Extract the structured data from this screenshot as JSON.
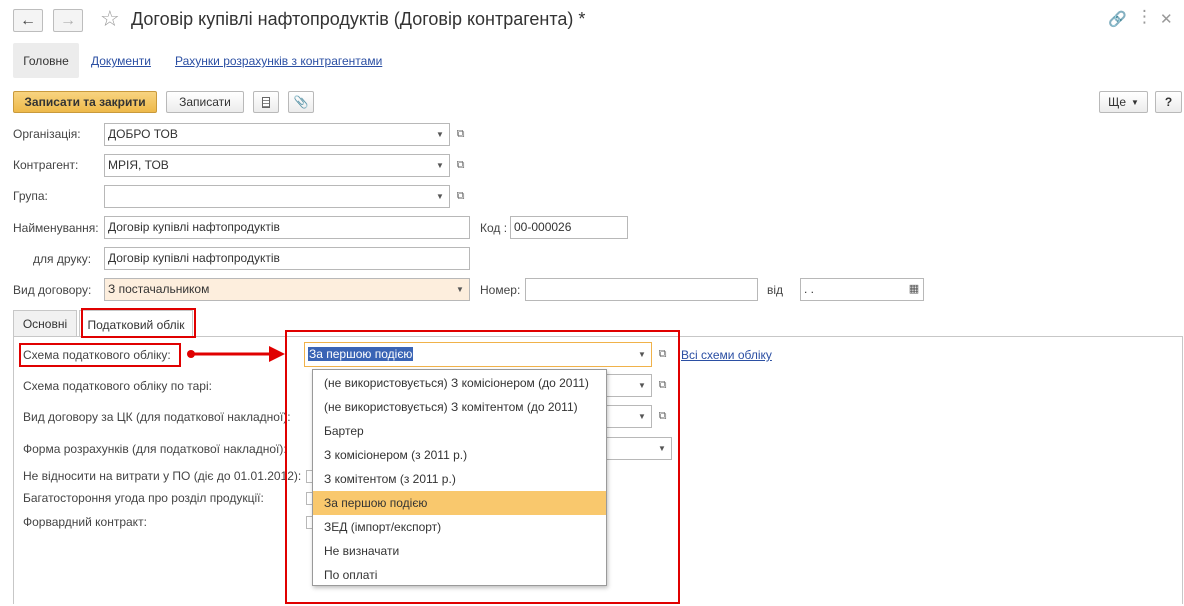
{
  "window": {
    "title": "Договір купівлі нафтопродуктів (Договір контрагента) *",
    "back_icon": "arrow-left-icon",
    "forward_icon": "arrow-right-icon"
  },
  "top_tabs": {
    "main": "Головне",
    "documents": "Документи",
    "accounts": "Рахунки розрахунків з контрагентами"
  },
  "toolbar": {
    "save_close": "Записати та закрити",
    "save": "Записати",
    "more": "Ще",
    "help": "?"
  },
  "form": {
    "organization": {
      "label": "Організація:",
      "value": "ДОБРО ТОВ"
    },
    "counterparty": {
      "label": "Контрагент:",
      "value": "МРІЯ, ТОВ"
    },
    "group": {
      "label": "Група:",
      "value": ""
    },
    "name": {
      "label": "Найменування:",
      "value": "Договір купівлі нафтопродуктів"
    },
    "code": {
      "label": "Код :",
      "value": "00-000026"
    },
    "print_name": {
      "label": "для друку:",
      "value": "Договір купівлі нафтопродуктів"
    },
    "contract_type": {
      "label": "Вид договору:",
      "value": "З постачальником"
    },
    "number": {
      "label": "Номер:",
      "value": ""
    },
    "date": {
      "label": "від",
      "value": " .  ."
    }
  },
  "page_tabs": {
    "basic": "Основні",
    "tax": "Податковий облік"
  },
  "tax_panel": {
    "scheme_label": "Схема податкового обліку:",
    "scheme_value": "За першою подією",
    "all_schemes_link": "Всі схеми обліку",
    "tare_scheme_label": "Схема податкового обліку по тарі:",
    "ck_type_label": "Вид договору за ЦК (для податкової накладної):",
    "payment_form_label": "Форма розрахунків (для податкової накладної):",
    "no_expense_label": "Не відносити на витрати у ПО (діє до 01.01.2012):",
    "multilateral_label": "Багатостороння угода про розділ продукції:",
    "forward_label": "Форвардний контракт:"
  },
  "dropdown_options": [
    "(не використовується) З комісіонером (до 2011)",
    "(не використовується) З комітентом (до 2011)",
    "Бартер",
    "З комісіонером (з 2011 р.)",
    "З комітентом (з 2011 р.)",
    "За першою подією",
    "ЗЕД (імпорт/експорт)",
    "Не визначати",
    "По оплаті"
  ],
  "dropdown_selected_index": 5,
  "colors": {
    "primary_button": "#eeb94a",
    "annotation_red": "#e00000",
    "selected_option": "#f9c86d",
    "link": "#2b4fa3"
  }
}
